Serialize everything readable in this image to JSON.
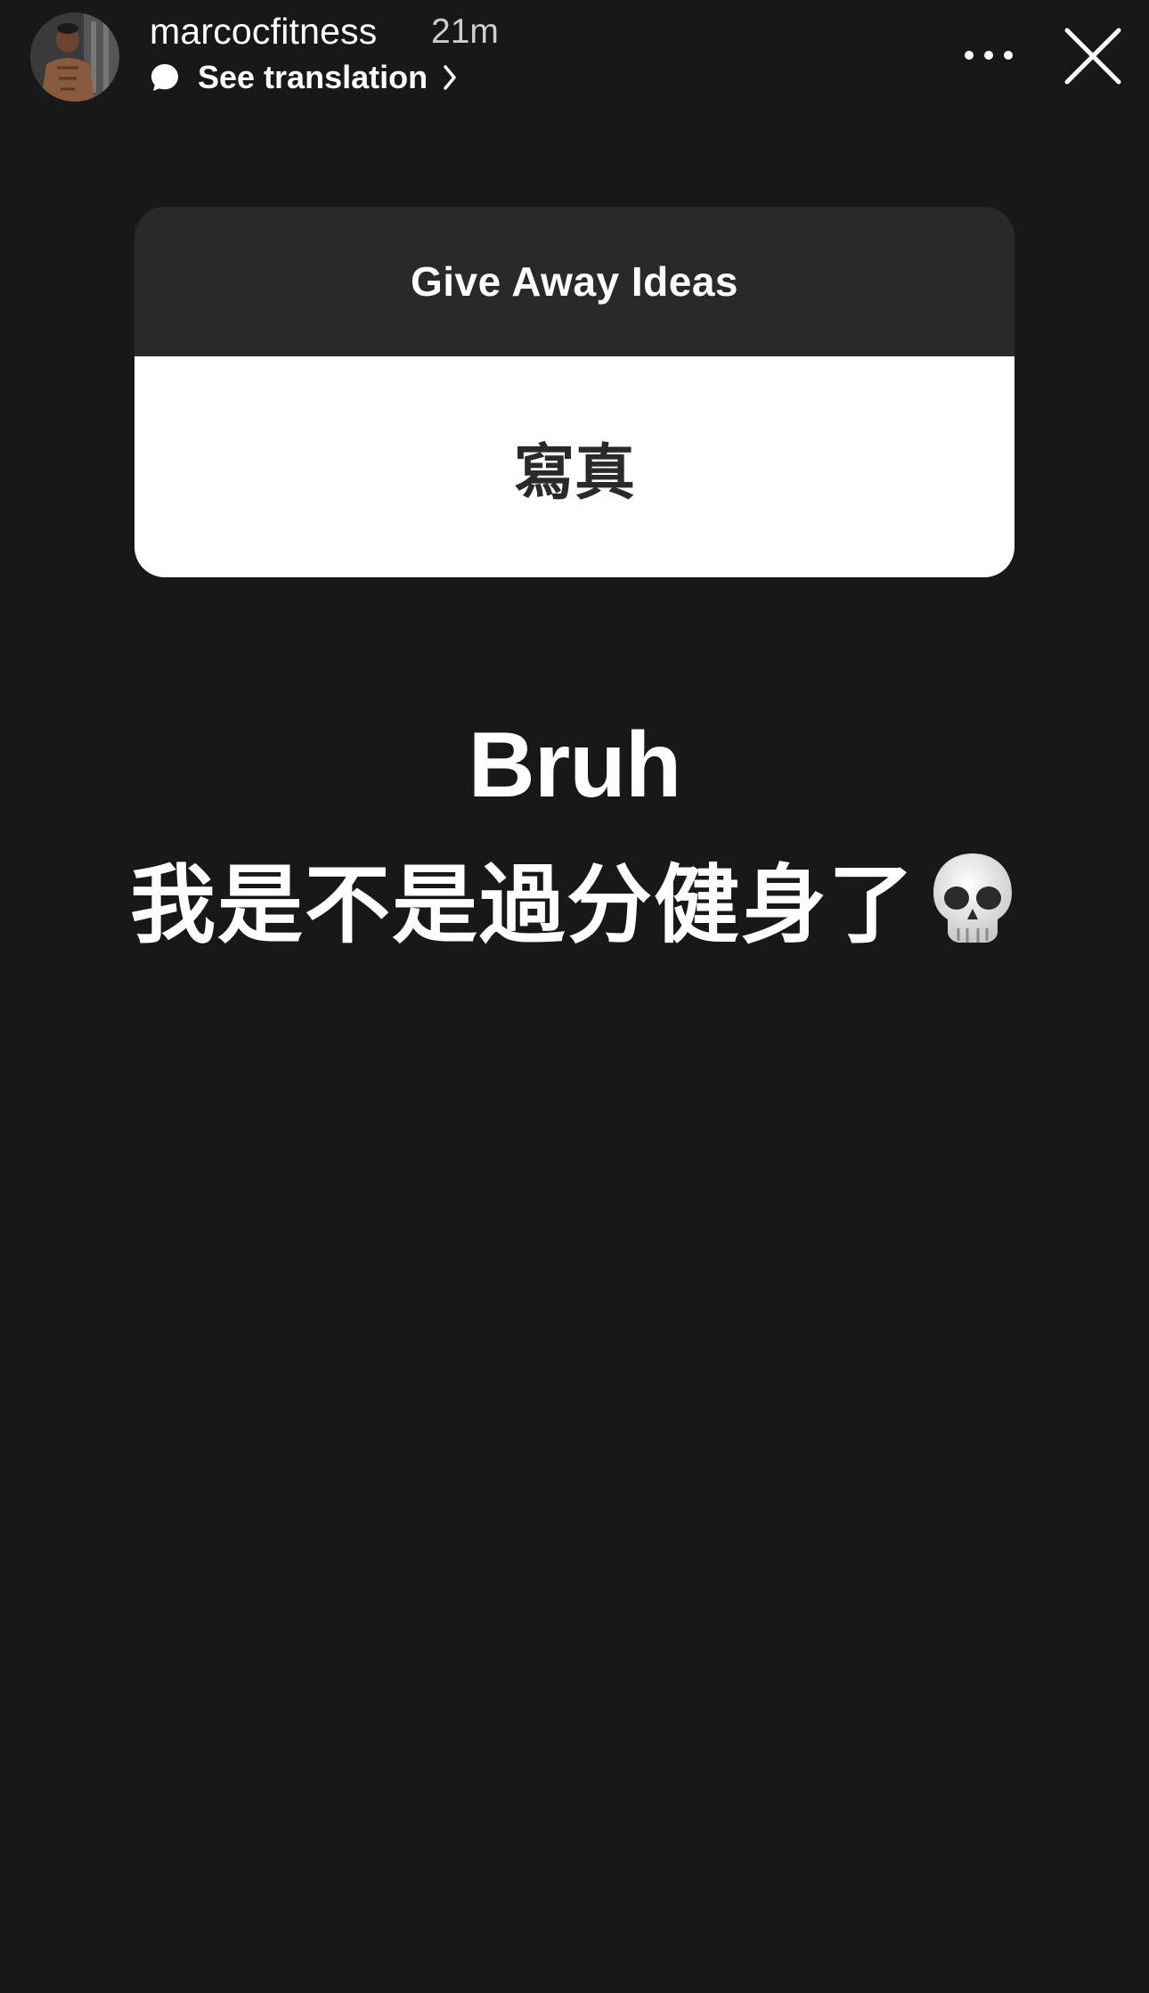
{
  "story": {
    "username": "marcocfitness",
    "timestamp": "21m",
    "translation_label": "See translation"
  },
  "question_sticker": {
    "question": "Give Away Ideas",
    "answer": "寫真"
  },
  "caption": {
    "line1": "Bruh",
    "line2": "我是不是過分健身了"
  },
  "icons": {
    "avatar": "profile-photo",
    "translation": "speech-bubble-icon",
    "chevron": "chevron-right-icon",
    "more": "more-horizontal-icon",
    "close": "close-icon",
    "emoji": "skull-emoji"
  },
  "colors": {
    "background": "#181818",
    "sticker_header": "#292929",
    "sticker_body": "#ffffff",
    "text_primary": "#ffffff"
  }
}
